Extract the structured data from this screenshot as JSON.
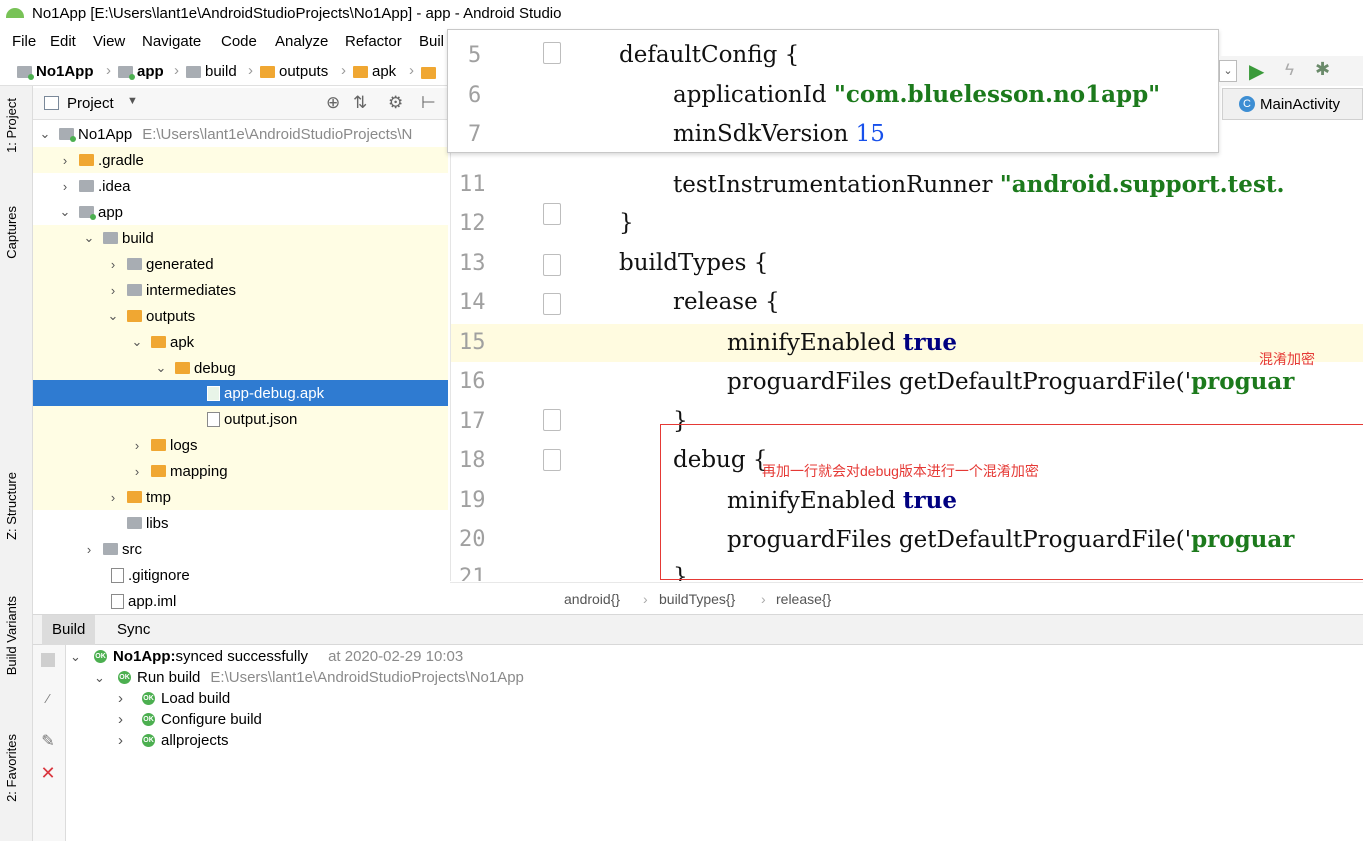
{
  "window": {
    "title": "No1App [E:\\Users\\lant1e\\AndroidStudioProjects\\No1App] - app - Android Studio"
  },
  "menu": [
    "File",
    "Edit",
    "View",
    "Navigate",
    "Code",
    "Analyze",
    "Refactor",
    "Buil"
  ],
  "nav": {
    "crumbs": [
      "No1App",
      "app",
      "build",
      "outputs",
      "apk"
    ]
  },
  "left_strip": {
    "tabs": [
      "1: Project",
      "Captures",
      "Z: Structure",
      "Build Variants",
      "2: Favorites"
    ]
  },
  "project_panel": {
    "header": "Project",
    "tree": [
      {
        "label": "No1App",
        "path": "E:\\Users\\lant1e\\AndroidStudioProjects\\N",
        "expanded": true,
        "icon": "module-folder-icon"
      },
      {
        "label": ".gradle",
        "expanded": false,
        "icon": "folder-icon"
      },
      {
        "label": ".idea",
        "expanded": false,
        "icon": "grey-folder-icon"
      },
      {
        "label": "app",
        "expanded": true,
        "icon": "module-folder-icon"
      },
      {
        "label": "build",
        "expanded": true,
        "icon": "grey-folder-icon"
      },
      {
        "label": "generated",
        "expanded": false,
        "icon": "grey-folder-icon"
      },
      {
        "label": "intermediates",
        "expanded": false,
        "icon": "grey-folder-icon"
      },
      {
        "label": "outputs",
        "expanded": true,
        "icon": "folder-icon"
      },
      {
        "label": "apk",
        "expanded": true,
        "icon": "folder-icon"
      },
      {
        "label": "debug",
        "expanded": true,
        "icon": "folder-icon"
      },
      {
        "label": "app-debug.apk",
        "icon": "apk-file-icon",
        "selected": true
      },
      {
        "label": "output.json",
        "icon": "json-file-icon"
      },
      {
        "label": "logs",
        "expanded": false,
        "icon": "folder-icon"
      },
      {
        "label": "mapping",
        "expanded": false,
        "icon": "folder-icon"
      },
      {
        "label": "tmp",
        "expanded": false,
        "icon": "folder-icon"
      },
      {
        "label": "libs",
        "icon": "grey-folder-icon"
      },
      {
        "label": "src",
        "expanded": false,
        "icon": "grey-folder-icon"
      },
      {
        "label": ".gitignore",
        "icon": "gitignore-file-icon"
      },
      {
        "label": "app.iml",
        "icon": "iml-file-icon"
      }
    ]
  },
  "editor_tab": {
    "label": "MainActivity"
  },
  "popup_lines": [
    {
      "num": "5",
      "code": "defaultConfig {"
    },
    {
      "num": "6",
      "code_pre": "applicationId ",
      "string": "\"com.bluelesson.no1app\""
    },
    {
      "num": "7",
      "code_pre": "minSdkVersion ",
      "number": "15"
    }
  ],
  "code_lines": [
    {
      "num": "11",
      "code_pre": "testInstrumentationRunner ",
      "string": "\"android.support.test."
    },
    {
      "num": "12",
      "code": "}"
    },
    {
      "num": "13",
      "code": "buildTypes {"
    },
    {
      "num": "14",
      "code": "release {"
    },
    {
      "num": "15",
      "code_pre": "minifyEnabled ",
      "keyword": "true"
    },
    {
      "num": "16",
      "code_pre": "proguardFiles getDefaultProguardFile('",
      "string": "proguar"
    },
    {
      "num": "17",
      "code": "}"
    },
    {
      "num": "18",
      "code": "debug {"
    },
    {
      "num": "19",
      "code_pre": "minifyEnabled ",
      "keyword": "true"
    },
    {
      "num": "20",
      "code_pre": "proguardFiles getDefaultProguardFile('",
      "string": "proguar"
    },
    {
      "num": "21",
      "code": "}"
    }
  ],
  "annotations": {
    "top": "混淆加密",
    "box": "再加一行就会对debug版本进行一个混淆加密"
  },
  "breadcrumb": [
    "android{}",
    "buildTypes{}",
    "release{}"
  ],
  "bottom_tabs": [
    "Build",
    "Sync"
  ],
  "build_output": [
    {
      "label": "No1App:",
      "suffix": " synced successfully",
      "time": "at 2020-02-29 10:03"
    },
    {
      "label": "Run build",
      "path": "E:\\Users\\lant1e\\AndroidStudioProjects\\No1App"
    },
    {
      "label": "Load build"
    },
    {
      "label": "Configure build"
    },
    {
      "label": "allprojects"
    }
  ],
  "colors": {
    "selection": "#2f7bd1",
    "annotation": "#e53935",
    "string": "#1c7a1c",
    "keyword": "#000080"
  }
}
